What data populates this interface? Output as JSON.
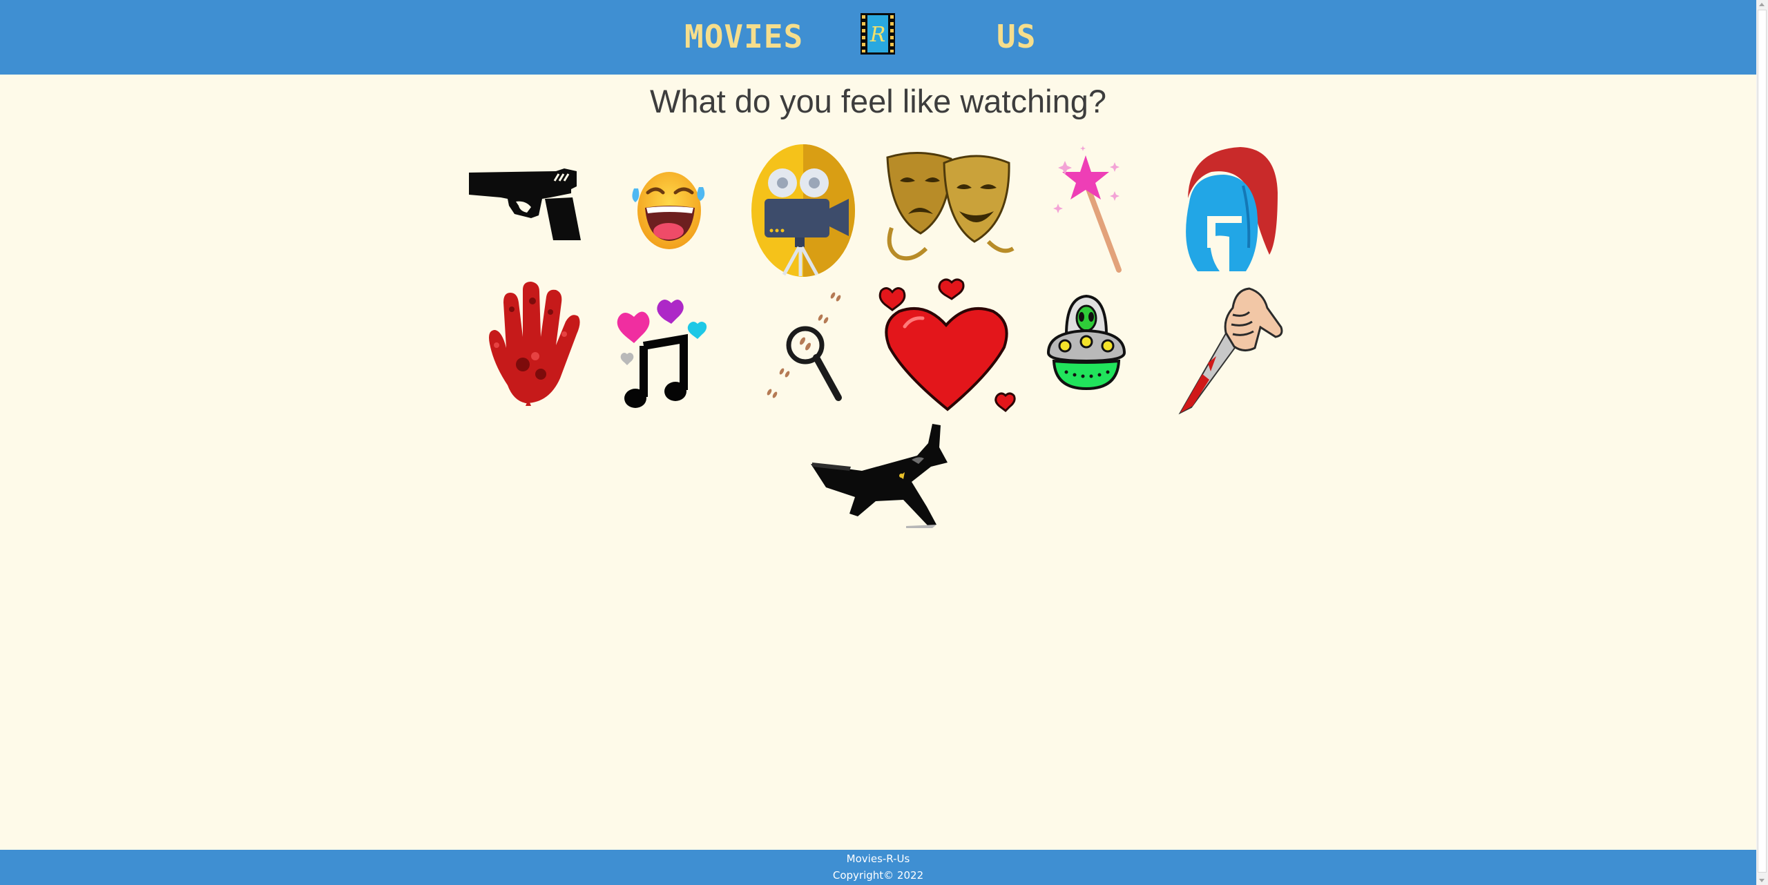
{
  "header": {
    "brand_left": "MOVIES",
    "brand_logo_letter": "R",
    "brand_right": "US",
    "colors": {
      "bar": "#3f8fd2",
      "brand_text": "#f6de8c"
    }
  },
  "main": {
    "heading": "What do you feel like watching?",
    "genre_icons": [
      "pistol-icon",
      "laughing-emoji-icon",
      "movie-camera-icon",
      "drama-masks-icon",
      "magic-wand-icon",
      "spartan-helmet-icon",
      "bloody-hand-icon",
      "music-note-hearts-icon",
      "magnifying-glass-footprints-icon",
      "heart-icon",
      "ufo-alien-icon",
      "bloody-knife-icon",
      "fighter-plane-icon"
    ]
  },
  "footer": {
    "name": "Movies-R-Us",
    "copyright": "Copyright© 2022"
  },
  "colors": {
    "page_background": "#fefae9"
  }
}
